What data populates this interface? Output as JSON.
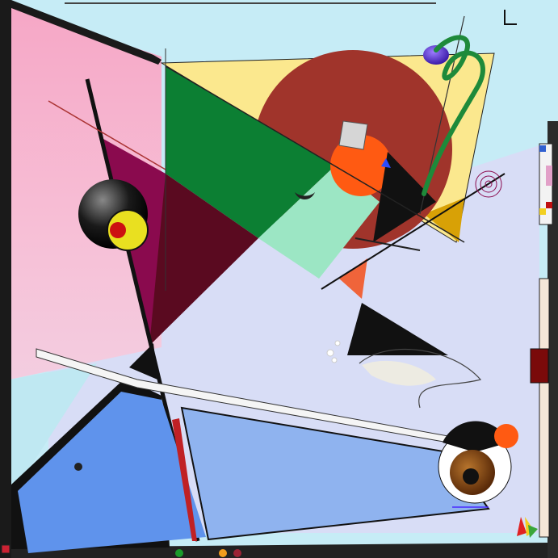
{
  "artwork": {
    "style": "geometric abstract composition",
    "palette": {
      "pink": "#f7b8cf",
      "sky": "#c6ecf6",
      "lavender": "#d9dcf6",
      "yellow": "#fbe88e",
      "green": "#0c7f33",
      "dark_red": "#a0342b",
      "orange": "#ff5a12",
      "magenta": "#8a0a4e",
      "maroon": "#5a0a20",
      "mint": "#9ce6c4",
      "blue": "#5f93ec",
      "light_blue": "#8fb3ef",
      "black": "#111111",
      "gold": "#d8a106"
    },
    "bottom_dots": [
      "#1b9b2b",
      "#222222",
      "#222222",
      "#f29c1c",
      "#9b2335"
    ]
  }
}
